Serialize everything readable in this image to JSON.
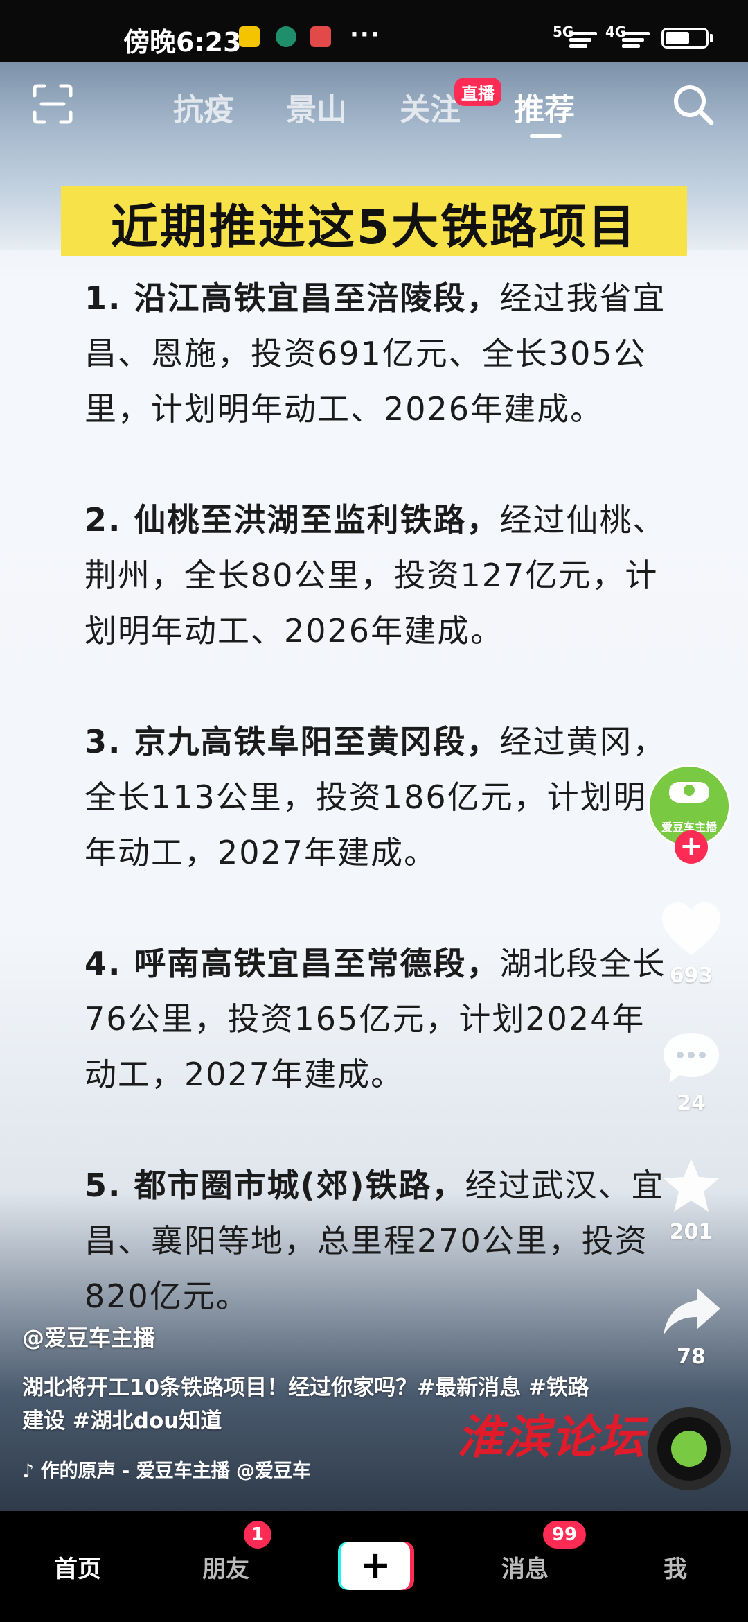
{
  "status_bar": {
    "time": "傍晚6:23",
    "more": "···",
    "network_1": "5G",
    "network_2": "4G"
  },
  "top_nav": {
    "tabs": [
      {
        "label": "抗疫"
      },
      {
        "label": "景山"
      },
      {
        "label": "关注"
      },
      {
        "label": "推荐"
      }
    ],
    "live_badge": "直播",
    "active_tab": "推荐"
  },
  "video": {
    "headline": "近期推进这5大铁路项目",
    "items": [
      {
        "title": "1. 沿江高铁宜昌至涪陵段，",
        "body": "经过我省宜昌、恩施，投资691亿元、全长305公里，计划明年动工、2026年建成。"
      },
      {
        "title": "2. 仙桃至洪湖至监利铁路，",
        "body": "经过仙桃、荆州，全长80公里，投资127亿元，计划明年动工、2026年建成。"
      },
      {
        "title": "3. 京九高铁阜阳至黄冈段，",
        "body": "经过黄冈，全长113公里，投资186亿元，计划明年动工，2027年建成。"
      },
      {
        "title": "4. 呼南高铁宜昌至常德段，",
        "body": "湖北段全长76公里，投资165亿元，计划2024年动工，2027年建成。"
      },
      {
        "title": "5. 都市圈市城(郊)铁路，",
        "body": "经过武汉、宜昌、襄阳等地，总里程270公里，投资820亿元。"
      }
    ],
    "author": "@爱豆车主播",
    "description": "湖北将开工10条铁路项目！经过你家吗？#最新消息 #铁路建设 #湖北dou知道",
    "music": "作的原声 - 爱豆车主播      @爱豆车",
    "watermark": "淮滨论坛",
    "avatar_label": "爱豆车主播"
  },
  "actions": {
    "likes": "693",
    "comments": "24",
    "favorites": "201",
    "shares": "78"
  },
  "bottom_nav": {
    "home": "首页",
    "friends": "朋友",
    "friends_badge": "1",
    "messages": "消息",
    "messages_badge": "99",
    "me": "我"
  },
  "colors": {
    "accent": "#fe2c55",
    "cyan": "#25f4ee",
    "headline_bg": "#f8e24a"
  }
}
